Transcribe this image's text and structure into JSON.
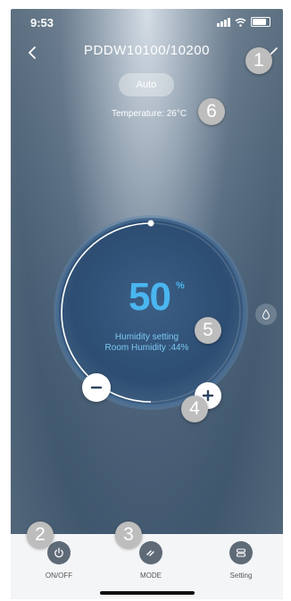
{
  "status_bar": {
    "time": "9:53"
  },
  "header": {
    "title": "PDDW10100/10200"
  },
  "mode": {
    "label": "Auto"
  },
  "temperature": {
    "text": "Temperature: 26°C"
  },
  "dial": {
    "value": "50",
    "unit": "%",
    "setting_label": "Humidity setting",
    "room_humidity": "Room Humidity :44%",
    "level": 0.5
  },
  "bottom_bar": {
    "items": [
      {
        "label": "ON/OFF",
        "icon": "power-icon"
      },
      {
        "label": "MODE",
        "icon": "mode-icon"
      },
      {
        "label": "Setting",
        "icon": "setting-icon"
      }
    ]
  },
  "callouts": [
    "1",
    "2",
    "3",
    "4",
    "5",
    "6"
  ],
  "colors": {
    "accent": "#4ab6f0",
    "badge": "#bdbdbd",
    "bottom_icon": "#5f6a77",
    "bottom_bar": "#f4f5f7"
  }
}
